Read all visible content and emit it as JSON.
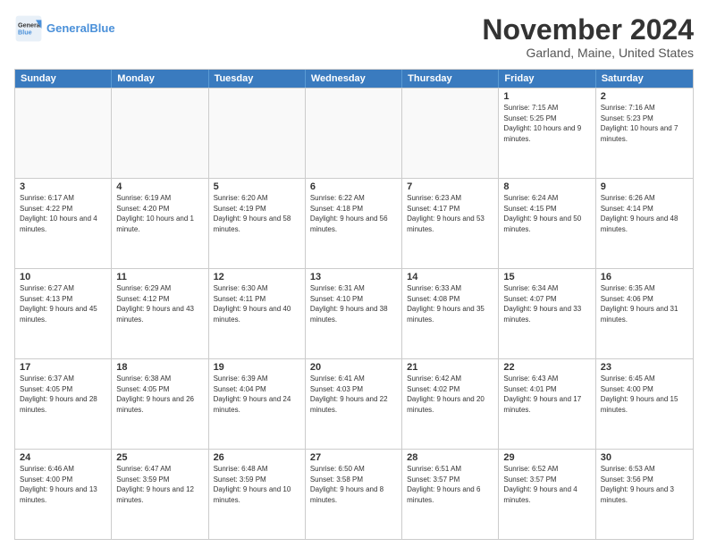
{
  "header": {
    "logo_line1": "General",
    "logo_line2": "Blue",
    "month_title": "November 2024",
    "location": "Garland, Maine, United States"
  },
  "calendar": {
    "days_of_week": [
      "Sunday",
      "Monday",
      "Tuesday",
      "Wednesday",
      "Thursday",
      "Friday",
      "Saturday"
    ],
    "rows": [
      [
        {
          "day": "",
          "info": ""
        },
        {
          "day": "",
          "info": ""
        },
        {
          "day": "",
          "info": ""
        },
        {
          "day": "",
          "info": ""
        },
        {
          "day": "",
          "info": ""
        },
        {
          "day": "1",
          "info": "Sunrise: 7:15 AM\nSunset: 5:25 PM\nDaylight: 10 hours and 9 minutes."
        },
        {
          "day": "2",
          "info": "Sunrise: 7:16 AM\nSunset: 5:23 PM\nDaylight: 10 hours and 7 minutes."
        }
      ],
      [
        {
          "day": "3",
          "info": "Sunrise: 6:17 AM\nSunset: 4:22 PM\nDaylight: 10 hours and 4 minutes."
        },
        {
          "day": "4",
          "info": "Sunrise: 6:19 AM\nSunset: 4:20 PM\nDaylight: 10 hours and 1 minute."
        },
        {
          "day": "5",
          "info": "Sunrise: 6:20 AM\nSunset: 4:19 PM\nDaylight: 9 hours and 58 minutes."
        },
        {
          "day": "6",
          "info": "Sunrise: 6:22 AM\nSunset: 4:18 PM\nDaylight: 9 hours and 56 minutes."
        },
        {
          "day": "7",
          "info": "Sunrise: 6:23 AM\nSunset: 4:17 PM\nDaylight: 9 hours and 53 minutes."
        },
        {
          "day": "8",
          "info": "Sunrise: 6:24 AM\nSunset: 4:15 PM\nDaylight: 9 hours and 50 minutes."
        },
        {
          "day": "9",
          "info": "Sunrise: 6:26 AM\nSunset: 4:14 PM\nDaylight: 9 hours and 48 minutes."
        }
      ],
      [
        {
          "day": "10",
          "info": "Sunrise: 6:27 AM\nSunset: 4:13 PM\nDaylight: 9 hours and 45 minutes."
        },
        {
          "day": "11",
          "info": "Sunrise: 6:29 AM\nSunset: 4:12 PM\nDaylight: 9 hours and 43 minutes."
        },
        {
          "day": "12",
          "info": "Sunrise: 6:30 AM\nSunset: 4:11 PM\nDaylight: 9 hours and 40 minutes."
        },
        {
          "day": "13",
          "info": "Sunrise: 6:31 AM\nSunset: 4:10 PM\nDaylight: 9 hours and 38 minutes."
        },
        {
          "day": "14",
          "info": "Sunrise: 6:33 AM\nSunset: 4:08 PM\nDaylight: 9 hours and 35 minutes."
        },
        {
          "day": "15",
          "info": "Sunrise: 6:34 AM\nSunset: 4:07 PM\nDaylight: 9 hours and 33 minutes."
        },
        {
          "day": "16",
          "info": "Sunrise: 6:35 AM\nSunset: 4:06 PM\nDaylight: 9 hours and 31 minutes."
        }
      ],
      [
        {
          "day": "17",
          "info": "Sunrise: 6:37 AM\nSunset: 4:05 PM\nDaylight: 9 hours and 28 minutes."
        },
        {
          "day": "18",
          "info": "Sunrise: 6:38 AM\nSunset: 4:05 PM\nDaylight: 9 hours and 26 minutes."
        },
        {
          "day": "19",
          "info": "Sunrise: 6:39 AM\nSunset: 4:04 PM\nDaylight: 9 hours and 24 minutes."
        },
        {
          "day": "20",
          "info": "Sunrise: 6:41 AM\nSunset: 4:03 PM\nDaylight: 9 hours and 22 minutes."
        },
        {
          "day": "21",
          "info": "Sunrise: 6:42 AM\nSunset: 4:02 PM\nDaylight: 9 hours and 20 minutes."
        },
        {
          "day": "22",
          "info": "Sunrise: 6:43 AM\nSunset: 4:01 PM\nDaylight: 9 hours and 17 minutes."
        },
        {
          "day": "23",
          "info": "Sunrise: 6:45 AM\nSunset: 4:00 PM\nDaylight: 9 hours and 15 minutes."
        }
      ],
      [
        {
          "day": "24",
          "info": "Sunrise: 6:46 AM\nSunset: 4:00 PM\nDaylight: 9 hours and 13 minutes."
        },
        {
          "day": "25",
          "info": "Sunrise: 6:47 AM\nSunset: 3:59 PM\nDaylight: 9 hours and 12 minutes."
        },
        {
          "day": "26",
          "info": "Sunrise: 6:48 AM\nSunset: 3:59 PM\nDaylight: 9 hours and 10 minutes."
        },
        {
          "day": "27",
          "info": "Sunrise: 6:50 AM\nSunset: 3:58 PM\nDaylight: 9 hours and 8 minutes."
        },
        {
          "day": "28",
          "info": "Sunrise: 6:51 AM\nSunset: 3:57 PM\nDaylight: 9 hours and 6 minutes."
        },
        {
          "day": "29",
          "info": "Sunrise: 6:52 AM\nSunset: 3:57 PM\nDaylight: 9 hours and 4 minutes."
        },
        {
          "day": "30",
          "info": "Sunrise: 6:53 AM\nSunset: 3:56 PM\nDaylight: 9 hours and 3 minutes."
        }
      ]
    ]
  }
}
